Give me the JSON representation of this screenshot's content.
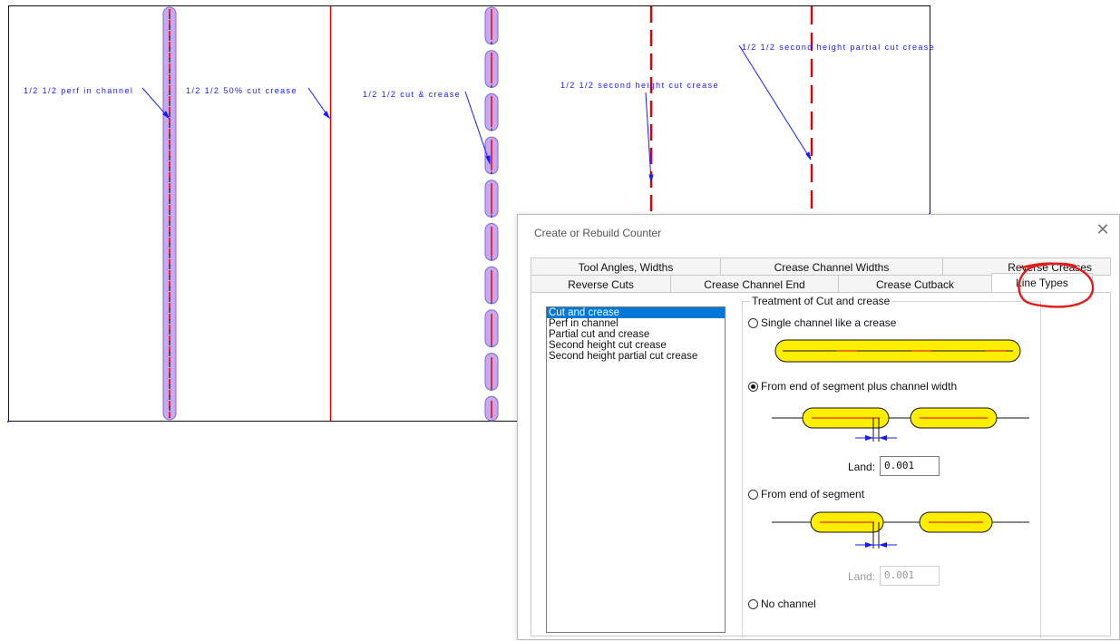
{
  "drawing": {
    "labels": [
      "1/2 1/2 perf in channel",
      "1/2 1/2 50% cut crease",
      "1/2 1/2 cut & crease",
      "1/2 1/2 second height cut crease",
      "1/2 1/2 second height partial cut crease"
    ]
  },
  "dialog": {
    "title": "Create or Rebuild Counter",
    "close_glyph": "✕",
    "tabs_row1": [
      "Tool Angles, Widths",
      "Crease Channel Widths",
      "Reverse Creases"
    ],
    "tabs_row2": [
      "Reverse Cuts",
      "Crease Channel End",
      "Crease Cutback",
      "Line Types"
    ],
    "active_tab": "Line Types",
    "line_types": [
      "Cut and crease",
      "Perf in channel",
      "Partial cut and crease",
      "Second height cut crease",
      "Second height partial cut crease"
    ],
    "selected_line_type": "Cut and crease",
    "treatment": {
      "legend": "Treatment of Cut and crease",
      "options": [
        "Single channel like a crease",
        "From end of segment plus channel width",
        "From end of segment",
        "No channel"
      ],
      "selected_option": "From end of segment plus channel width",
      "land_label": "Land:",
      "land_value_1": "0.001",
      "land_value_2": "0.001"
    }
  },
  "colors": {
    "label_blue": "#1a1aff",
    "cut_red": "#e00000",
    "channel_fill": "#c9a8f0",
    "channel_stroke": "#7b6ad8",
    "yellow": "#ffee00",
    "highlight": "#0078d7",
    "annotation_red": "#e31b1b"
  }
}
